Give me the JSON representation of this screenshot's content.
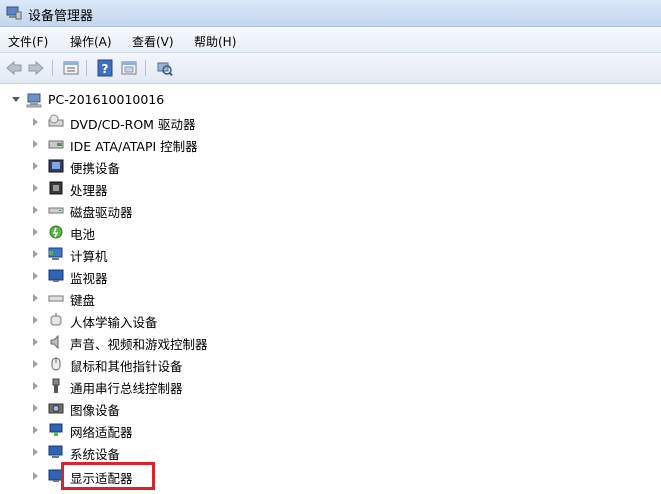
{
  "window": {
    "title": "设备管理器"
  },
  "menu": [
    {
      "label": "文件(F)"
    },
    {
      "label": "操作(A)"
    },
    {
      "label": "查看(V)"
    },
    {
      "label": "帮助(H)"
    }
  ],
  "toolbar": {
    "icons": [
      "back-arrow-icon",
      "forward-arrow-icon",
      "properties-icon",
      "help-icon",
      "show-hide-icon",
      "scan-hardware-icon"
    ]
  },
  "tree": {
    "root": {
      "label": "PC-201610010016",
      "expanded": true
    },
    "items": [
      {
        "label": "DVD/CD-ROM 驱动器",
        "icon": "dvd-drive-icon"
      },
      {
        "label": "IDE ATA/ATAPI 控制器",
        "icon": "ide-controller-icon"
      },
      {
        "label": "便携设备",
        "icon": "portable-device-icon"
      },
      {
        "label": "处理器",
        "icon": "processor-icon"
      },
      {
        "label": "磁盘驱动器",
        "icon": "disk-drive-icon"
      },
      {
        "label": "电池",
        "icon": "battery-icon"
      },
      {
        "label": "计算机",
        "icon": "computer-icon"
      },
      {
        "label": "监视器",
        "icon": "monitor-icon"
      },
      {
        "label": "键盘",
        "icon": "keyboard-icon"
      },
      {
        "label": "人体学输入设备",
        "icon": "hid-icon"
      },
      {
        "label": "声音、视频和游戏控制器",
        "icon": "sound-icon"
      },
      {
        "label": "鼠标和其他指针设备",
        "icon": "mouse-icon"
      },
      {
        "label": "通用串行总线控制器",
        "icon": "usb-icon"
      },
      {
        "label": "图像设备",
        "icon": "imaging-device-icon"
      },
      {
        "label": "网络适配器",
        "icon": "network-adapter-icon"
      },
      {
        "label": "系统设备",
        "icon": "system-device-icon"
      },
      {
        "label": "显示适配器",
        "icon": "display-adapter-icon",
        "highlighted": true
      }
    ]
  },
  "colors": {
    "highlight_border": "#d9242c"
  }
}
